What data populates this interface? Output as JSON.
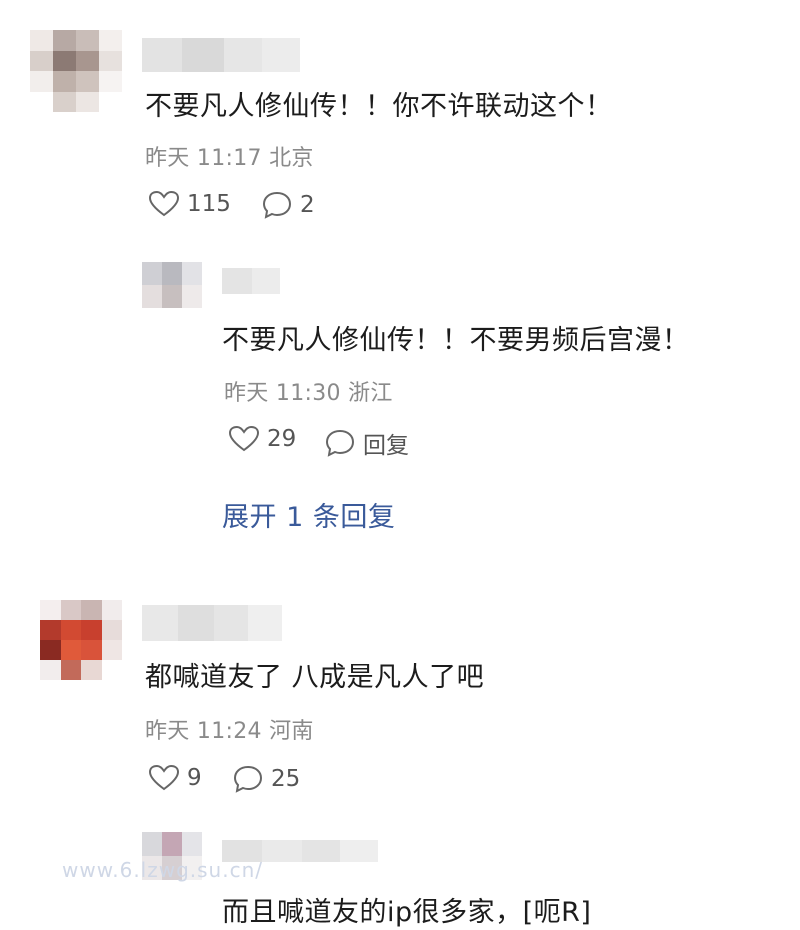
{
  "comments": [
    {
      "text": "不要凡人修仙传！！你不许联动这个！",
      "meta": "昨天 11:17 北京",
      "likes": "115",
      "replies": "2"
    },
    {
      "text": "都喊道友了 八成是凡人了吧",
      "meta": "昨天 11:24 河南",
      "likes": "9",
      "replies": "25"
    }
  ],
  "sub_replies": [
    {
      "text": "不要凡人修仙传！！不要男频后宫漫！",
      "meta": "昨天 11:30 浙江",
      "likes": "29",
      "reply_label": "回复"
    },
    {
      "text": "而且喊道友的ip很多家，[呃R]"
    }
  ],
  "expand_label": "展开 1 条回复",
  "watermark": "www.6.lzwg.su.cn/",
  "colors": {
    "link": "#3a5a9a",
    "meta": "#8a8a8a"
  }
}
